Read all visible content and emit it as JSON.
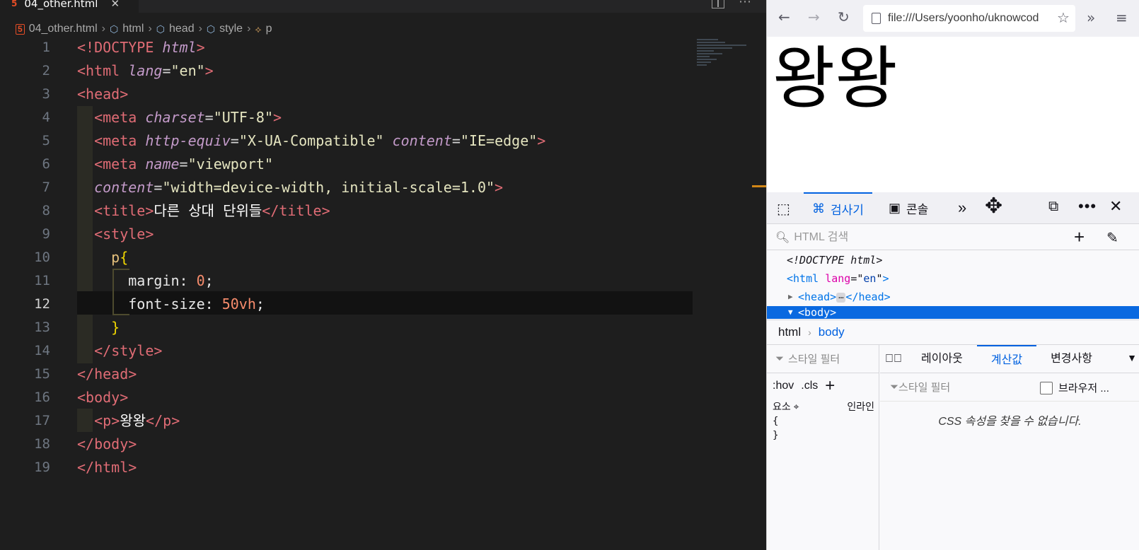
{
  "editor": {
    "tab_title": "04_other.html",
    "breadcrumb": [
      "04_other.html",
      "html",
      "head",
      "style",
      "p"
    ],
    "line_numbers": [
      "1",
      "2",
      "3",
      "4",
      "5",
      "6",
      "7",
      "8",
      "9",
      "10",
      "11",
      "12",
      "13",
      "14",
      "15",
      "16",
      "17",
      "18",
      "19"
    ],
    "active_line": "12",
    "doc_start": "<!DOCTYPE",
    "doc_html": "html",
    "tag_html": "html",
    "attr_lang": "lang",
    "val_en": "\"en\"",
    "tag_head": "head",
    "tag_meta": "meta",
    "attr_charset": "charset",
    "val_utf8": "\"UTF-8\"",
    "attr_http_equiv": "http-equiv",
    "val_compat": "\"X-UA-Compatible\"",
    "attr_content": "content",
    "val_ie": "\"IE=edge\"",
    "attr_name": "name",
    "val_viewport": "\"viewport\"",
    "val_width": "\"width=device-width, initial-scale=1.0\"",
    "tag_title": "title",
    "title_text": "다른 상대 단위들",
    "tag_style": "style",
    "css_selector": "p",
    "css_margin_prop": "margin",
    "css_margin_val": "0",
    "css_fs_prop": "font-size",
    "css_fs_val": "50vh",
    "tag_body": "body",
    "tag_p": "p",
    "p_text": "왕왕"
  },
  "browser": {
    "url": "file:///Users/yoonho/uknowcod",
    "page_text": "왕왕",
    "devtools": {
      "tab_inspector": "검사기",
      "tab_console": "콘솔",
      "search_placeholder": "HTML 검색",
      "tree": {
        "doctype": "<!DOCTYPE html>",
        "html_tag": "html",
        "lang_attr": "lang",
        "lang_val": "en",
        "head_tag": "head",
        "body_tag": "body"
      },
      "crumb_html": "html",
      "crumb_body": "body",
      "style_filter": "스타일 필터",
      "hov": ":hov",
      "cls": ".cls",
      "element_label": "요소",
      "inline_label": "인라인",
      "tab_layout": "레이아웃",
      "tab_computed": "계산값",
      "tab_changes": "변경사항",
      "computed_filter": "스타일 필터",
      "browser_styles": "브라우저 ...",
      "empty_message": "CSS 속성을 찾을 수 없습니다."
    }
  }
}
